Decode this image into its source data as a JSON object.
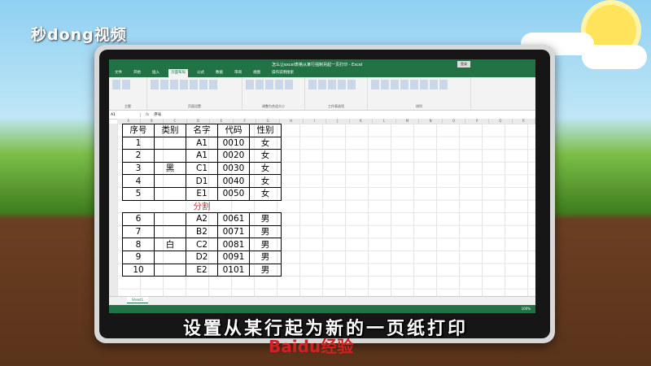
{
  "brand": {
    "logo_text": "秒dong视频"
  },
  "subtitle": "设置从某行起为新的一页纸打印",
  "watermark": "Baidu经验",
  "excel": {
    "window_title": "怎么让excel表格从某行强制另起一页打印 - Excel",
    "login_label": "登录",
    "tabs": [
      "文件",
      "开始",
      "插入",
      "页面布局",
      "公式",
      "数据",
      "审阅",
      "视图",
      "操作说明搜索"
    ],
    "active_tab_index": 3,
    "ribbon_groups": [
      "主题",
      "页面设置",
      "调整为合适大小",
      "工作表选项",
      "排列"
    ],
    "name_box": "A1",
    "formula": "序号",
    "columns": [
      "A",
      "B",
      "C",
      "D",
      "E",
      "F",
      "G",
      "H",
      "I",
      "J",
      "K",
      "L",
      "M",
      "N",
      "O",
      "P",
      "Q",
      "R"
    ],
    "headers": [
      "序号",
      "类别",
      "名字",
      "代码",
      "性别"
    ],
    "rows": [
      {
        "num": "1",
        "cat": "",
        "name": "A1",
        "code": "0010",
        "sex": "女"
      },
      {
        "num": "2",
        "cat": "",
        "name": "A1",
        "code": "0020",
        "sex": "女"
      },
      {
        "num": "3",
        "cat": "黑",
        "name": "C1",
        "code": "0030",
        "sex": "女"
      },
      {
        "num": "4",
        "cat": "",
        "name": "D1",
        "code": "0040",
        "sex": "女"
      },
      {
        "num": "5",
        "cat": "",
        "name": "E1",
        "code": "0050",
        "sex": "女"
      }
    ],
    "split_label": "分割",
    "rows2": [
      {
        "num": "6",
        "cat": "",
        "name": "A2",
        "code": "0061",
        "sex": "男"
      },
      {
        "num": "7",
        "cat": "",
        "name": "B2",
        "code": "0071",
        "sex": "男"
      },
      {
        "num": "8",
        "cat": "白",
        "name": "C2",
        "code": "0081",
        "sex": "男"
      },
      {
        "num": "9",
        "cat": "",
        "name": "D2",
        "code": "0091",
        "sex": "男"
      },
      {
        "num": "10",
        "cat": "",
        "name": "E2",
        "code": "0101",
        "sex": "男"
      }
    ],
    "sheet_tab": "Sheet1",
    "zoom": "100%"
  }
}
